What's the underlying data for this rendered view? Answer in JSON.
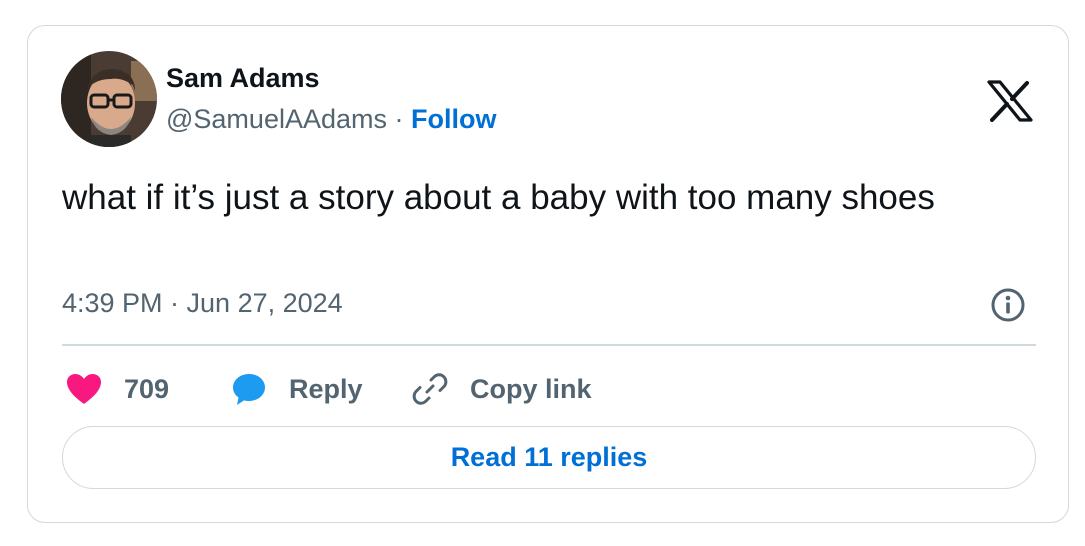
{
  "author": {
    "name": "Sam Adams",
    "handle": "@SamuelAAdams",
    "separator": "·",
    "follow_label": "Follow"
  },
  "tweet": {
    "text": "what if it’s just a story about a baby with too many shoes",
    "timestamp": "4:39 PM · Jun 27, 2024"
  },
  "actions": {
    "like_count": "709",
    "reply_label": "Reply",
    "copy_link_label": "Copy link"
  },
  "read_replies_label": "Read 11 replies",
  "icons": {
    "brand": "x-logo-icon",
    "info": "info-icon",
    "like": "heart-icon",
    "reply": "speech-bubble-icon",
    "copy": "link-icon"
  },
  "colors": {
    "accent_blue": "#006fd6",
    "like_pink": "#f91880",
    "reply_blue": "#1d9bf0",
    "muted_text": "#536471",
    "border": "#cfd9de"
  }
}
